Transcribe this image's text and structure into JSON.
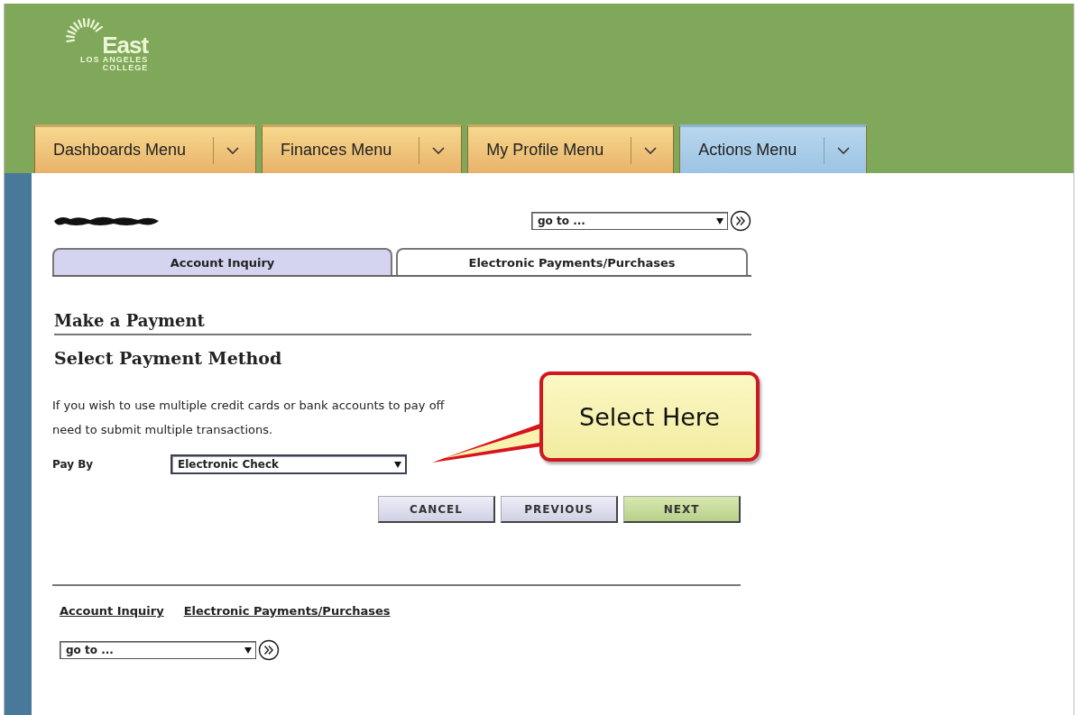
{
  "logo": {
    "name": "East",
    "subtitle_1": "LOS ANGELES",
    "subtitle_2": "COLLEGE"
  },
  "menus": [
    {
      "label": "Dashboards Menu",
      "selected": false
    },
    {
      "label": "Finances Menu",
      "selected": false
    },
    {
      "label": "My Profile Menu",
      "selected": false
    },
    {
      "label": "Actions Menu",
      "selected": true
    }
  ],
  "goto_top": {
    "value": "go to ..."
  },
  "tabs": [
    {
      "label": "Account Inquiry",
      "selected": false
    },
    {
      "label": "Electronic Payments/Purchases",
      "selected": true
    }
  ],
  "section_title": "Make a Payment",
  "subtitle": "Select Payment Method",
  "instructions": [
    "If you wish to use multiple credit cards or bank accounts to pay off",
    "need to submit multiple transactions."
  ],
  "pay_by": {
    "label": "Pay By",
    "value": "Electronic Check"
  },
  "buttons": [
    {
      "label": "CANCEL",
      "kind": "plain"
    },
    {
      "label": "PREVIOUS",
      "kind": "plain"
    },
    {
      "label": "NEXT",
      "kind": "primary"
    }
  ],
  "footer_links": [
    "Account Inquiry",
    "Electronic Payments/Purchases"
  ],
  "goto_bottom": {
    "value": "go to ..."
  },
  "callout": {
    "text": "Select Here"
  }
}
